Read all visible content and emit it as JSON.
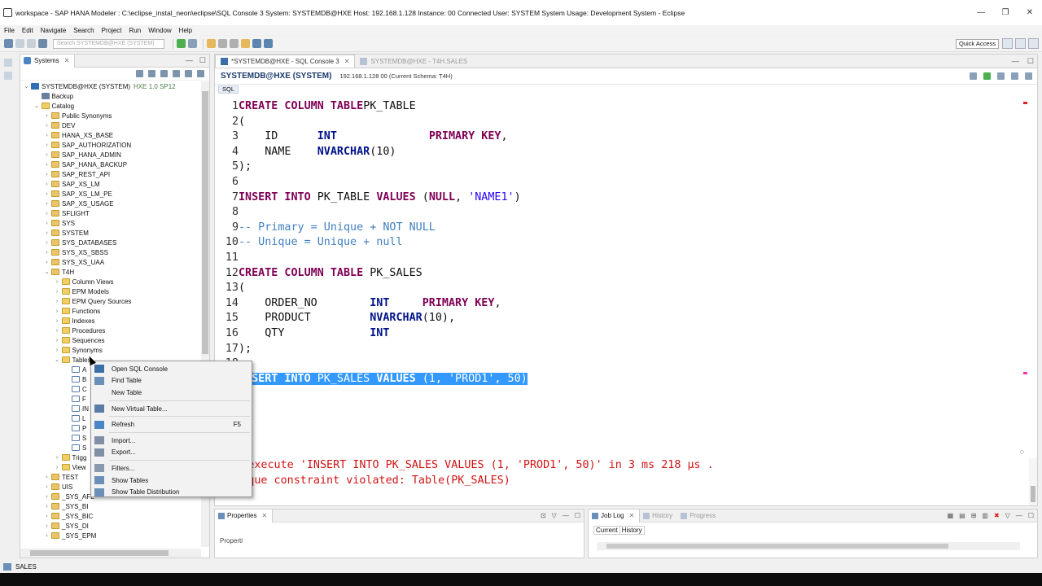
{
  "window": {
    "title": "workspace - SAP HANA Modeler : C:\\eclipse_instal_neon\\eclipse\\SQL Console 3 System: SYSTEMDB@HXE Host: 192.168.1.128 Instance: 00 Connected User: SYSTEM System Usage: Development System - Eclipse",
    "minimize": "—",
    "restore": "❐",
    "close": "✕"
  },
  "menu": [
    "File",
    "Edit",
    "Navigate",
    "Search",
    "Project",
    "Run",
    "Window",
    "Help"
  ],
  "toolbar": {
    "search_placeholder": "Search SYSTEMDB@HXE (SYSTEM)",
    "quick_access": "Quick Access"
  },
  "systems_panel": {
    "tab_label": "Systems",
    "tree": [
      {
        "indent": 0,
        "twisty": "v",
        "icon": "sys",
        "label": "SYSTEMDB@HXE (SYSTEM)",
        "sub": "HXE 1.0 SP12"
      },
      {
        "indent": 1,
        "twisty": "",
        "icon": "db",
        "label": "Backup"
      },
      {
        "indent": 1,
        "twisty": "v",
        "icon": "folder",
        "label": "Catalog"
      },
      {
        "indent": 2,
        "twisty": ">",
        "icon": "schema",
        "label": "Public Synonyms"
      },
      {
        "indent": 2,
        "twisty": ">",
        "icon": "schema",
        "label": "DEV"
      },
      {
        "indent": 2,
        "twisty": ">",
        "icon": "schema",
        "label": "HANA_XS_BASE"
      },
      {
        "indent": 2,
        "twisty": ">",
        "icon": "schema",
        "label": "SAP_AUTHORIZATION"
      },
      {
        "indent": 2,
        "twisty": ">",
        "icon": "schema",
        "label": "SAP_HANA_ADMIN"
      },
      {
        "indent": 2,
        "twisty": ">",
        "icon": "schema",
        "label": "SAP_HANA_BACKUP"
      },
      {
        "indent": 2,
        "twisty": ">",
        "icon": "schema",
        "label": "SAP_REST_API"
      },
      {
        "indent": 2,
        "twisty": ">",
        "icon": "schema",
        "label": "SAP_XS_LM"
      },
      {
        "indent": 2,
        "twisty": ">",
        "icon": "schema",
        "label": "SAP_XS_LM_PE"
      },
      {
        "indent": 2,
        "twisty": ">",
        "icon": "schema",
        "label": "SAP_XS_USAGE"
      },
      {
        "indent": 2,
        "twisty": ">",
        "icon": "schema",
        "label": "SFLIGHT"
      },
      {
        "indent": 2,
        "twisty": ">",
        "icon": "schema",
        "label": "SYS"
      },
      {
        "indent": 2,
        "twisty": ">",
        "icon": "schema",
        "label": "SYSTEM"
      },
      {
        "indent": 2,
        "twisty": ">",
        "icon": "schema",
        "label": "SYS_DATABASES"
      },
      {
        "indent": 2,
        "twisty": ">",
        "icon": "schema",
        "label": "SYS_XS_SBSS"
      },
      {
        "indent": 2,
        "twisty": ">",
        "icon": "schema",
        "label": "SYS_XS_UAA"
      },
      {
        "indent": 2,
        "twisty": "v",
        "icon": "schema",
        "label": "T4H"
      },
      {
        "indent": 3,
        "twisty": ">",
        "icon": "folder",
        "label": "Column Views"
      },
      {
        "indent": 3,
        "twisty": ">",
        "icon": "folder",
        "label": "EPM Models"
      },
      {
        "indent": 3,
        "twisty": ">",
        "icon": "folder",
        "label": "EPM Query Sources"
      },
      {
        "indent": 3,
        "twisty": ">",
        "icon": "folder",
        "label": "Functions"
      },
      {
        "indent": 3,
        "twisty": ">",
        "icon": "folder",
        "label": "Indexes"
      },
      {
        "indent": 3,
        "twisty": ">",
        "icon": "folder",
        "label": "Procedures"
      },
      {
        "indent": 3,
        "twisty": ">",
        "icon": "folder",
        "label": "Sequences"
      },
      {
        "indent": 3,
        "twisty": ">",
        "icon": "folder",
        "label": "Synonyms"
      },
      {
        "indent": 3,
        "twisty": "v",
        "icon": "folder",
        "label": "Tables"
      },
      {
        "indent": 4,
        "twisty": "",
        "icon": "tbl",
        "label": "A"
      },
      {
        "indent": 4,
        "twisty": "",
        "icon": "tbl",
        "label": "B"
      },
      {
        "indent": 4,
        "twisty": "",
        "icon": "tbl",
        "label": "C"
      },
      {
        "indent": 4,
        "twisty": "",
        "icon": "tbl",
        "label": "F"
      },
      {
        "indent": 4,
        "twisty": "",
        "icon": "tbl",
        "label": "IN"
      },
      {
        "indent": 4,
        "twisty": "",
        "icon": "tbl",
        "label": "L"
      },
      {
        "indent": 4,
        "twisty": "",
        "icon": "tbl",
        "label": "P"
      },
      {
        "indent": 4,
        "twisty": "",
        "icon": "tbl",
        "label": "S"
      },
      {
        "indent": 4,
        "twisty": "",
        "icon": "tbl",
        "label": "S"
      },
      {
        "indent": 3,
        "twisty": ">",
        "icon": "folder",
        "label": "Trigg"
      },
      {
        "indent": 3,
        "twisty": ">",
        "icon": "folder",
        "label": "View"
      },
      {
        "indent": 2,
        "twisty": ">",
        "icon": "schema",
        "label": "TEST"
      },
      {
        "indent": 2,
        "twisty": ">",
        "icon": "schema",
        "label": "UIS"
      },
      {
        "indent": 2,
        "twisty": ">",
        "icon": "schema",
        "label": "_SYS_AFL"
      },
      {
        "indent": 2,
        "twisty": ">",
        "icon": "schema",
        "label": "_SYS_BI"
      },
      {
        "indent": 2,
        "twisty": ">",
        "icon": "schema",
        "label": "_SYS_BIC"
      },
      {
        "indent": 2,
        "twisty": ">",
        "icon": "schema",
        "label": "_SYS_DI"
      },
      {
        "indent": 2,
        "twisty": ">",
        "icon": "schema",
        "label": "_SYS_EPM"
      }
    ]
  },
  "editor": {
    "tabs": [
      {
        "label": "*SYSTEMDB@HXE - SQL Console 3",
        "active": true
      },
      {
        "label": "SYSTEMDB@HXE - T4H.SALES",
        "active": false
      }
    ],
    "connection": "SYSTEMDB@HXE (SYSTEM)",
    "host_info": "192.168.1.128 00 (Current Schema: T4H)",
    "sql_tab": "SQL",
    "lines": [
      {
        "n": "1",
        "tokens": [
          [
            "kw",
            "CREATE COLUMN TABLE"
          ],
          [
            "",
            "PK_TABLE"
          ]
        ]
      },
      {
        "n": "2",
        "tokens": [
          [
            "",
            "("
          ]
        ]
      },
      {
        "n": "3",
        "tokens": [
          [
            "",
            "    ID      "
          ],
          [
            "ty",
            "INT"
          ],
          [
            "",
            "              "
          ],
          [
            "kw",
            "PRIMARY KEY"
          ],
          [
            "",
            ","
          ]
        ]
      },
      {
        "n": "4",
        "tokens": [
          [
            "",
            "    NAME    "
          ],
          [
            "ty",
            "NVARCHAR"
          ],
          [
            "",
            "(10)"
          ]
        ]
      },
      {
        "n": "5",
        "tokens": [
          [
            "",
            ");"
          ]
        ]
      },
      {
        "n": "6",
        "tokens": []
      },
      {
        "n": "7",
        "tokens": [
          [
            "kw",
            "INSERT INTO"
          ],
          [
            "",
            " PK_TABLE "
          ],
          [
            "kw",
            "VALUES"
          ],
          [
            "",
            " ("
          ],
          [
            "kw",
            "NULL"
          ],
          [
            "",
            ", "
          ],
          [
            "str",
            "'NAME1'"
          ],
          [
            "",
            ")"
          ]
        ]
      },
      {
        "n": "8",
        "tokens": []
      },
      {
        "n": "9",
        "tokens": [
          [
            "cm",
            "-- Primary = Unique + NOT NULL"
          ]
        ]
      },
      {
        "n": "10",
        "tokens": [
          [
            "cm",
            "-- Unique = Unique + null"
          ]
        ]
      },
      {
        "n": "11",
        "tokens": []
      },
      {
        "n": "12",
        "tokens": [
          [
            "kw",
            "CREATE COLUMN TABLE"
          ],
          [
            "",
            " PK_SALES"
          ]
        ]
      },
      {
        "n": "13",
        "tokens": [
          [
            "",
            "("
          ]
        ]
      },
      {
        "n": "14",
        "tokens": [
          [
            "",
            "    ORDER_NO        "
          ],
          [
            "ty",
            "INT"
          ],
          [
            "",
            "     "
          ],
          [
            "kw",
            "PRIMARY KEY"
          ],
          [
            "",
            ","
          ]
        ]
      },
      {
        "n": "15",
        "tokens": [
          [
            "",
            "    PRODUCT         "
          ],
          [
            "ty",
            "NVARCHAR"
          ],
          [
            "",
            "(10),"
          ]
        ]
      },
      {
        "n": "16",
        "tokens": [
          [
            "",
            "    QTY             "
          ],
          [
            "ty",
            "INT"
          ]
        ]
      },
      {
        "n": "17",
        "tokens": [
          [
            "",
            ");"
          ]
        ]
      },
      {
        "n": "18",
        "tokens": []
      },
      {
        "n": "19",
        "selected": true,
        "tokens": [
          [
            "kw",
            "INSERT INTO"
          ],
          [
            "",
            " PK_SALES "
          ],
          [
            "kw",
            "VALUES"
          ],
          [
            "",
            " (1, "
          ],
          [
            "str",
            "'PROD1'"
          ],
          [
            "",
            ", 50)"
          ]
        ]
      }
    ],
    "result_lines": [
      " not execute 'INSERT INTO PK_SALES VALUES (1, 'PROD1', 50)' in 3 ms 218 µs .",
      ": unique constraint violated: Table(PK_SALES)"
    ]
  },
  "context_menu": {
    "items": [
      {
        "label": "Open SQL Console",
        "icon": "sql-console-icon",
        "color": "#3b6fa8"
      },
      {
        "label": "Find Table",
        "icon": "find-table-icon",
        "color": "#6a8fb8"
      },
      {
        "label": "New Table",
        "icon": "",
        "color": ""
      },
      {
        "sep": true
      },
      {
        "label": "New Virtual Table...",
        "icon": "virtual-table-icon",
        "color": "#5a7ca8"
      },
      {
        "sep": true
      },
      {
        "label": "Refresh",
        "icon": "refresh-icon",
        "color": "#4a86c5",
        "shortcut": "F5"
      },
      {
        "sep": true
      },
      {
        "label": "Import...",
        "icon": "import-icon",
        "color": "#7f8fa6"
      },
      {
        "label": "Export...",
        "icon": "export-icon",
        "color": "#7f8fa6"
      },
      {
        "sep": true
      },
      {
        "label": "Filters...",
        "icon": "filter-icon",
        "color": "#8a9aae"
      },
      {
        "label": "Show Tables",
        "icon": "show-tables-icon",
        "color": "#6a8fb8"
      },
      {
        "label": "Show Table Distribution",
        "icon": "table-distribution-icon",
        "color": "#6a8fb8"
      }
    ]
  },
  "properties": {
    "tab": "Properties",
    "body": "Properti"
  },
  "joblog": {
    "tabs": [
      "Job Log",
      "History",
      "Progress"
    ],
    "subtabs": [
      "Current",
      "History"
    ]
  },
  "status": {
    "text": "SALES"
  }
}
